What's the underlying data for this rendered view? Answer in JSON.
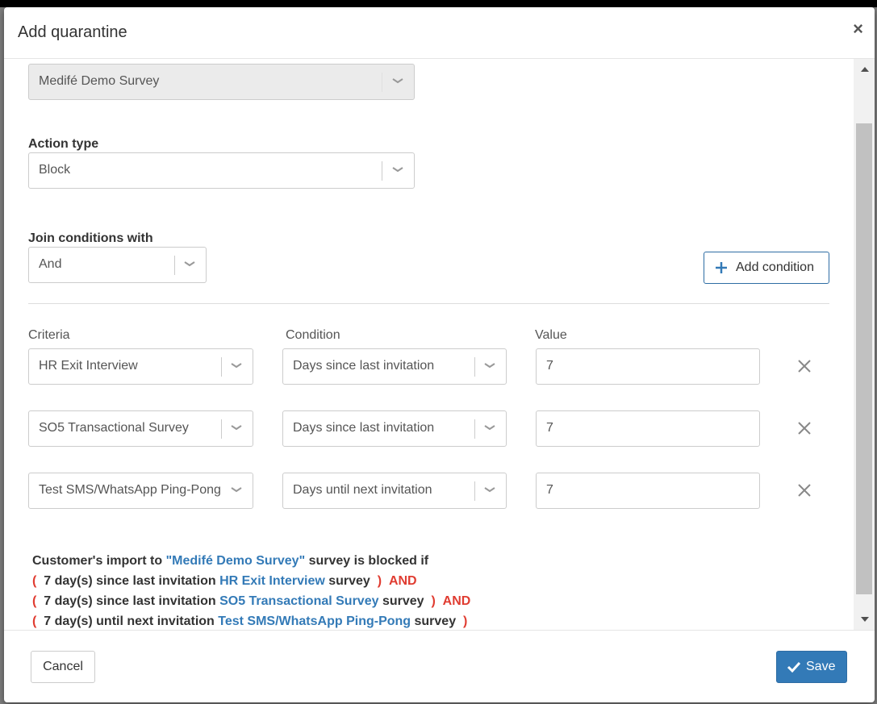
{
  "modal": {
    "title": "Add quarantine",
    "close_glyph": "×"
  },
  "survey_select": {
    "value": "Medifé Demo Survey"
  },
  "action_type": {
    "label": "Action type",
    "value": "Block"
  },
  "join": {
    "label": "Join conditions with",
    "value": "And"
  },
  "add_condition": {
    "label": "Add condition"
  },
  "columns": {
    "criteria": "Criteria",
    "condition": "Condition",
    "value": "Value"
  },
  "rows": [
    {
      "criteria": "HR Exit Interview",
      "condition": "Days since last invitation",
      "value": "7"
    },
    {
      "criteria": "SO5 Transactional Survey",
      "condition": "Days since last invitation",
      "value": "7"
    },
    {
      "criteria": "Test SMS/WhatsApp Ping-Pong",
      "condition": "Days until next invitation",
      "value": "7"
    }
  ],
  "summary": {
    "line0": {
      "prefix": "Customer's import to ",
      "survey": "\"Medifé Demo Survey\"",
      "suffix": " survey is blocked if"
    },
    "lines": [
      {
        "open": "(",
        "text": " 7 day(s) since last invitation ",
        "survey": "HR Exit Interview",
        "suffix": " survey ",
        "close": ")",
        "join": "AND"
      },
      {
        "open": "(",
        "text": " 7 day(s) since last invitation ",
        "survey": "SO5 Transactional Survey",
        "suffix": " survey ",
        "close": ")",
        "join": "AND"
      },
      {
        "open": "(",
        "text": " 7 day(s) until next invitation ",
        "survey": "Test SMS/WhatsApp Ping-Pong",
        "suffix": " survey ",
        "close": ")",
        "join": ""
      }
    ]
  },
  "footer": {
    "cancel": "Cancel",
    "save": "Save"
  },
  "colors": {
    "primary": "#337ab7",
    "red": "#e03c31",
    "disabled_bg": "#ebebeb"
  },
  "icons": {
    "dropdown": "chevron-down-icon",
    "remove": "close-icon",
    "add": "plus-icon",
    "save": "check-icon"
  }
}
